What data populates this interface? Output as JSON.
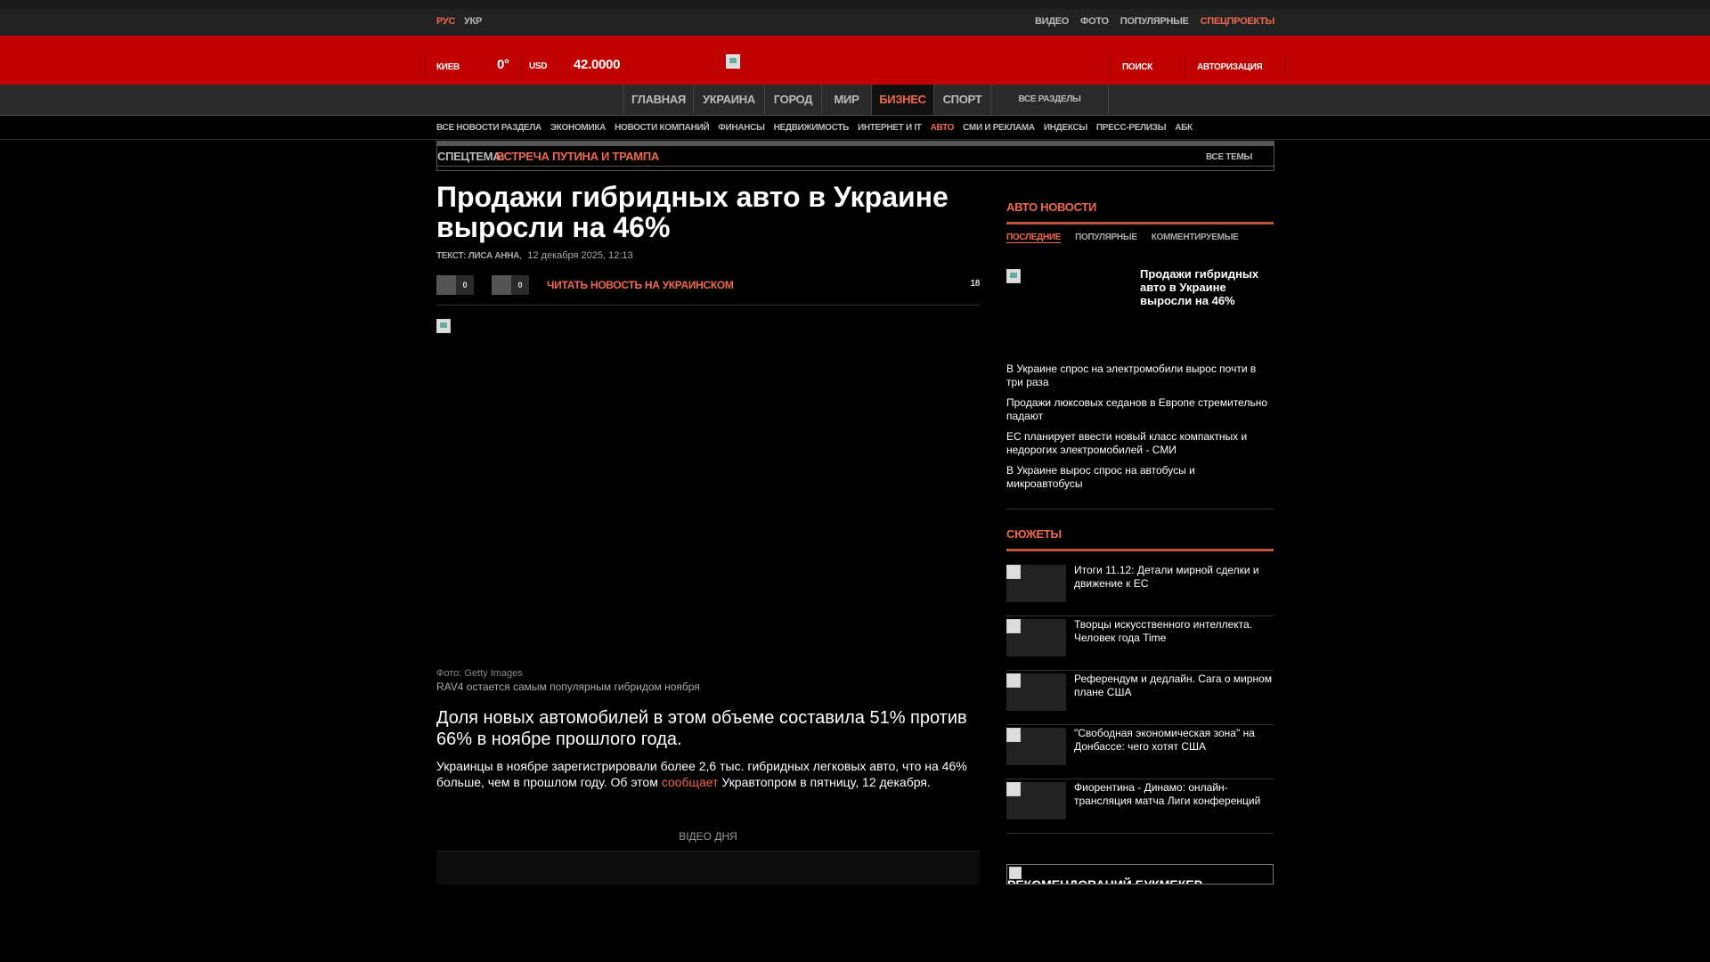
{
  "lang": {
    "rus": "РУС",
    "ukr": "УКР"
  },
  "topnav": [
    "ВИДЕО",
    "ФОТО",
    "ПОПУЛЯРНЫЕ",
    "СПЕЦПРОЕКТЫ"
  ],
  "header": {
    "city": "КИЕВ",
    "temp": "0°",
    "currency": "USD",
    "rate": "42.0000",
    "search": "ПОИСК",
    "auth": "АВТОРИЗАЦИЯ"
  },
  "mainnav": [
    "ГЛАВНАЯ",
    "УКРАИНА",
    "ГОРОД",
    "МИР",
    "БИЗНЕС",
    "СПОРТ",
    "ВСЕ РАЗДЕЛЫ"
  ],
  "subnav": [
    "ВСЕ НОВОСТИ РАЗДЕЛА",
    "ЭКОНОМИКА",
    "НОВОСТИ КОМПАНИЙ",
    "ФИНАНСЫ",
    "НЕДВИЖИМОСТЬ",
    "ИНТЕРНЕТ И IT",
    "АВТО",
    "СМИ И РЕКЛАМА",
    "ИНДЕКСЫ",
    "ПРЕСС-РЕЛИЗЫ",
    "АБК"
  ],
  "spec": {
    "label": "СПЕЦТЕМА:",
    "theme": "ВСТРЕЧА ПУТИНА И ТРАМПА",
    "all": "ВСЕ ТЕМЫ"
  },
  "article": {
    "title": "Продажи гибридных авто в Украине выросли на 46%",
    "author_label": "ТЕКСТ: ЛИСА АННА",
    "date": "12 декабря 2025, 12:13",
    "like_count": "0",
    "share_count": "0",
    "read_ukr": "ЧИТАТЬ НОВОСТЬ НА УКРАИНСКОМ",
    "comments": "18",
    "photo_credit": "Фото: Getty Images",
    "caption": "RAV4 остается самым популярным гибридом ноября",
    "lead": "Доля новых автомобилей в этом объеме составила 51% против 66% в ноябре прошлого года.",
    "para_before": "Украинцы в ноябре зарегистрировали более 2,6 тыс. гибридных легковых авто, что на 46% больше, чем в прошлом году. Об этом ",
    "para_link": "сообщает",
    "para_after": " Укравтопром в пятницу, 12 декабря.",
    "video_label": "ВІДЕО ДНЯ"
  },
  "sidebar": {
    "auto_heading": "АВТО НОВОСТИ",
    "tabs": [
      "ПОСЛЕДНИЕ",
      "ПОПУЛЯРНЫЕ",
      "КОММЕНТИРУЕМЫЕ"
    ],
    "featured": "Продажи гибридных авто в Украине выросли на 46%",
    "news": [
      "В Украине спрос на электромобили вырос почти в три раза",
      "Продажи люксовых седанов в Европе стремительно падают",
      "ЕС планирует ввести новый класс компактных и недорогих электромобилей - СМИ",
      "В Украине вырос спрос на автобусы и микроавтобусы"
    ],
    "stories_heading": "СЮЖЕТЫ",
    "stories": [
      "Итоги 11.12: Детали мирной сделки и движение к ЕС",
      "Творцы искусственного интеллекта. Человек года Time",
      "Референдум и дедлайн. Сага о мирном плане США",
      "\"Свободная экономическая зона\" на Донбассе: чего хотят США",
      "Фиорентина - Динамо: онлайн-трансляция матча Лиги конференций"
    ],
    "bookmaker": "РЕКОМЕНДОВАНИЙ БУКМЕКЕР"
  },
  "colors": {
    "accent": "#f06a4e",
    "header_red": "#c10000",
    "bg": "#000000"
  }
}
